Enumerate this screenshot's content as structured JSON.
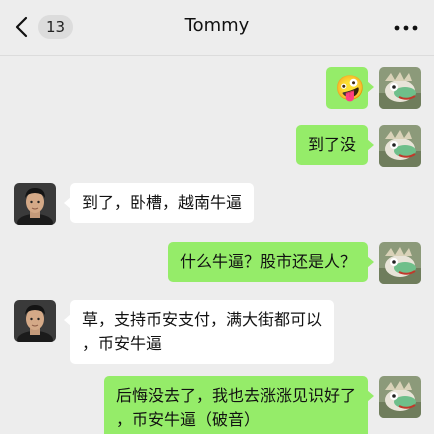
{
  "header": {
    "unread_count": "13",
    "title": "Tommy",
    "back_icon": "chevron-left-icon",
    "more_icon": "more-horizontal-icon"
  },
  "colors": {
    "background": "#ededed",
    "bubble_mine": "#95ec69",
    "bubble_theirs": "#ffffff"
  },
  "messages": [
    {
      "sender": "me",
      "emoji": "🤪"
    },
    {
      "sender": "me",
      "text": "到了没"
    },
    {
      "sender": "Tommy",
      "text": "到了，卧槽，越南牛逼"
    },
    {
      "sender": "me",
      "text": "什么牛逼？股市还是人？"
    },
    {
      "sender": "Tommy",
      "lines": [
        "草，支持币安支付，满大街都可以",
        "，币安牛逼"
      ]
    },
    {
      "sender": "me",
      "lines": [
        "后悔没去了，我也去涨涨见识好了",
        "，币安牛逼（破音）"
      ]
    }
  ]
}
